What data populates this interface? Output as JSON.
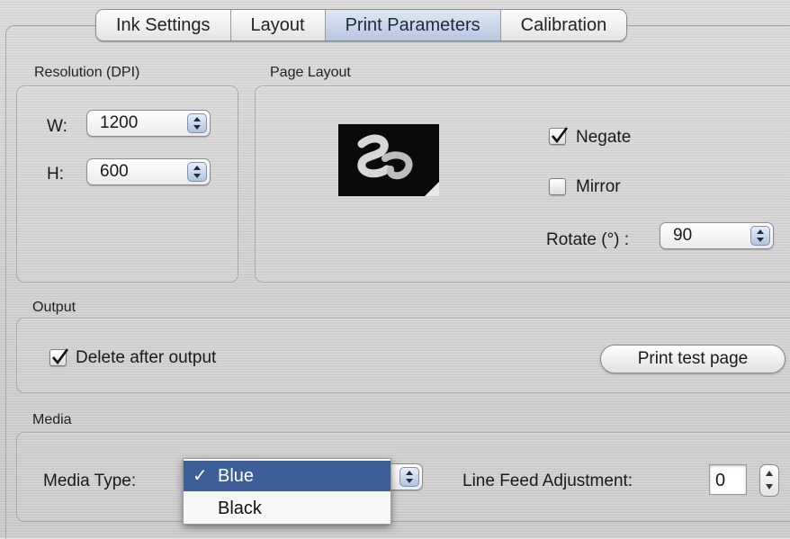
{
  "tabs": [
    "Ink Settings",
    "Layout",
    "Print Parameters",
    "Calibration"
  ],
  "active_tab": "Print Parameters",
  "resolution": {
    "title": "Resolution (DPI)",
    "w_label": "W:",
    "w_value": "1200",
    "h_label": "H:",
    "h_value": "600"
  },
  "page_layout": {
    "title": "Page Layout",
    "negate_label": "Negate",
    "negate_checked": true,
    "mirror_label": "Mirror",
    "mirror_checked": false,
    "rotate_label": "Rotate (°) :",
    "rotate_value": "90"
  },
  "output": {
    "title": "Output",
    "delete_label": "Delete after output",
    "delete_checked": true,
    "print_test_label": "Print test page"
  },
  "media": {
    "title": "Media",
    "media_type_label": "Media Type:",
    "options": [
      "Blue",
      "Black"
    ],
    "selected": "Blue",
    "line_feed_label": "Line Feed Adjustment:",
    "line_feed_value": "0"
  },
  "colors": {
    "selection": "#3c5f98",
    "active_tab": "#b7c6dd"
  }
}
